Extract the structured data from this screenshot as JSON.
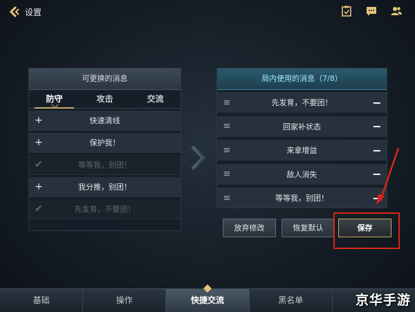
{
  "header": {
    "title": "设置",
    "icons": [
      "checklist-icon",
      "chat-bubble-icon",
      "friends-icon"
    ]
  },
  "left_panel": {
    "title": "可更换的消息",
    "tabs": [
      {
        "label": "防守",
        "active": true
      },
      {
        "label": "攻击",
        "active": false
      },
      {
        "label": "交流",
        "active": false
      }
    ],
    "items": [
      {
        "text": "快速清线",
        "state": "add"
      },
      {
        "text": "保护我！",
        "state": "add"
      },
      {
        "text": "等等我，别团！",
        "state": "added"
      },
      {
        "text": "我分推，别团！",
        "state": "add"
      },
      {
        "text": "先发育，不要团！",
        "state": "added"
      }
    ]
  },
  "right_panel": {
    "title": "局内使用的消息（7/8）",
    "items": [
      {
        "text": "先发育，不要团！"
      },
      {
        "text": "回家补状态"
      },
      {
        "text": "来拿增益"
      },
      {
        "text": "敌人消失"
      },
      {
        "text": "等等我，别团！"
      }
    ]
  },
  "buttons": {
    "discard": "放弃修改",
    "reset": "恢复默认",
    "save": "保存"
  },
  "bottom_nav": [
    {
      "label": "基础",
      "active": false
    },
    {
      "label": "操作",
      "active": false
    },
    {
      "label": "快捷交流",
      "active": true
    },
    {
      "label": "黑名单",
      "active": false
    },
    {
      "label": "",
      "active": false
    }
  ],
  "watermark": "京华手游",
  "colors": {
    "accent_gold": "#c8a86a",
    "accent_cyan": "#9fe6ff",
    "annotation_red": "#d8261b"
  }
}
